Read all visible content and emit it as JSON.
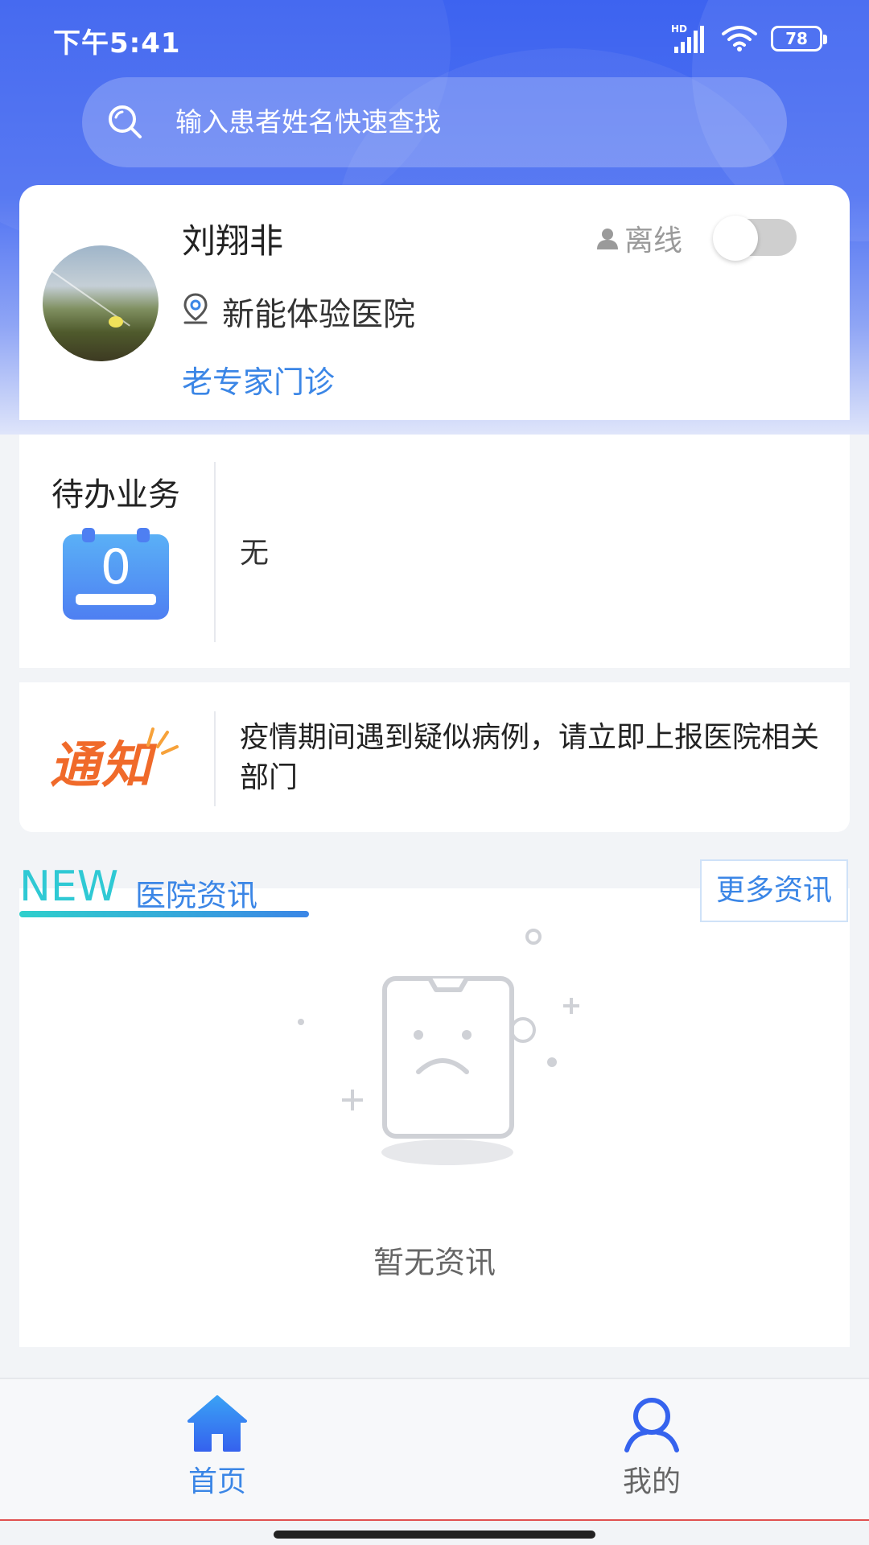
{
  "status_bar": {
    "time": "下午5:41",
    "network_label": "HD",
    "battery": "78"
  },
  "search": {
    "placeholder": "输入患者姓名快速查找"
  },
  "profile": {
    "name": "刘翔非",
    "hospital": "新能体验医院",
    "department": "老专家门诊",
    "status_label": "离线",
    "online": false
  },
  "todo": {
    "title": "待办业务",
    "count": "0",
    "content": "无"
  },
  "notice": {
    "logo_text": "通知",
    "text": "疫情期间遇到疑似病例，请立即上报医院相关部门"
  },
  "news": {
    "badge": "NEW",
    "title": "医院资讯",
    "more_label": "更多资讯",
    "empty_text": "暂无资讯"
  },
  "tabbar": {
    "tabs": [
      {
        "label": "首页",
        "icon": "home-icon",
        "active": true
      },
      {
        "label": "我的",
        "icon": "user-icon",
        "active": false
      }
    ]
  },
  "colors": {
    "primary": "#3b86e6",
    "hero_blue": "#3d63f0",
    "accent_teal": "#2fc9d4",
    "notice_orange": "#f06a2a"
  }
}
